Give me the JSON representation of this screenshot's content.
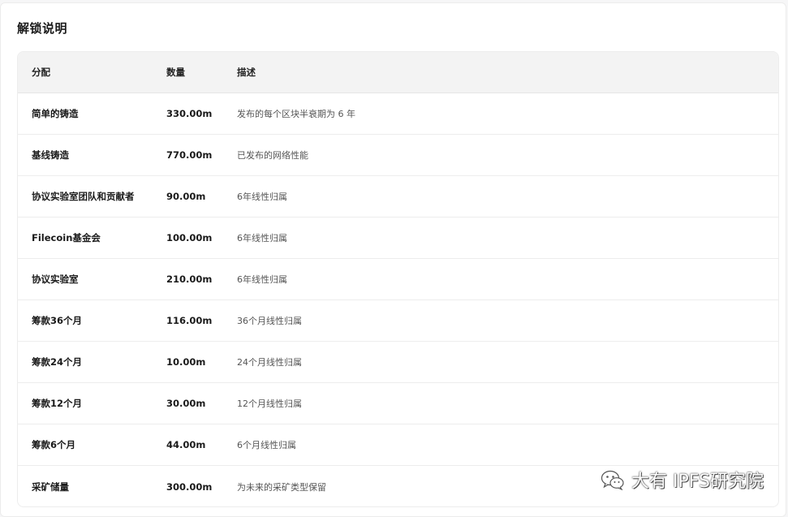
{
  "section_title": "解锁说明",
  "table": {
    "headers": [
      "分配",
      "数量",
      "描述"
    ],
    "rows": [
      {
        "name": "简单的铸造",
        "qty": "330.00m",
        "desc": "发布的每个区块半衰期为 6 年"
      },
      {
        "name": "基线铸造",
        "qty": "770.00m",
        "desc": "已发布的网络性能"
      },
      {
        "name": "协议实验室团队和贡献者",
        "qty": "90.00m",
        "desc": "6年线性归属"
      },
      {
        "name": "Filecoin基金会",
        "qty": "100.00m",
        "desc": "6年线性归属"
      },
      {
        "name": "协议实验室",
        "qty": "210.00m",
        "desc": "6年线性归属"
      },
      {
        "name": "筹款36个月",
        "qty": "116.00m",
        "desc": "36个月线性归属"
      },
      {
        "name": "筹款24个月",
        "qty": "10.00m",
        "desc": "24个月线性归属"
      },
      {
        "name": "筹款12个月",
        "qty": "30.00m",
        "desc": "12个月线性归属"
      },
      {
        "name": "筹款6个月",
        "qty": "44.00m",
        "desc": "6个月线性归属"
      },
      {
        "name": "采矿储量",
        "qty": "300.00m",
        "desc": "为未来的采矿类型保留"
      }
    ]
  },
  "watermark": {
    "text": "大有 IPFS研究院",
    "icon": "wechat-icon"
  }
}
